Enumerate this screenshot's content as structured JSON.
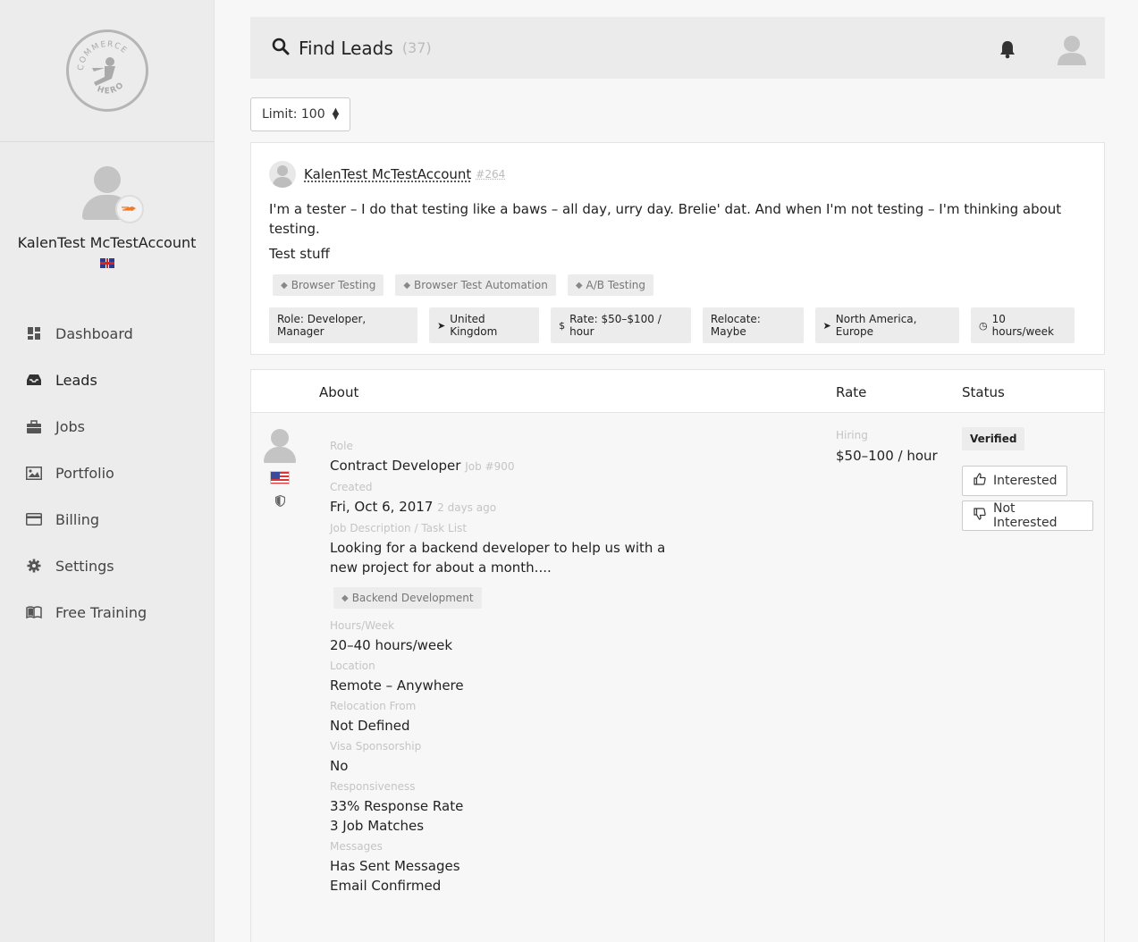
{
  "brand": {
    "logo_text_top": "COMMERCE",
    "logo_text_bottom": "HERO"
  },
  "profile": {
    "name": "KalenTest McTestAccount"
  },
  "nav": [
    {
      "label": "Dashboard",
      "icon": "dashboard-icon"
    },
    {
      "label": "Leads",
      "icon": "inbox-icon"
    },
    {
      "label": "Jobs",
      "icon": "briefcase-icon"
    },
    {
      "label": "Portfolio",
      "icon": "image-icon"
    },
    {
      "label": "Billing",
      "icon": "credit-card-icon"
    },
    {
      "label": "Settings",
      "icon": "gear-icon"
    },
    {
      "label": "Free Training",
      "icon": "book-icon"
    }
  ],
  "header": {
    "title": "Find Leads",
    "count": "(37)"
  },
  "limit": {
    "label": "Limit: 100"
  },
  "lead_profile": {
    "name": "KalenTest McTestAccount",
    "id": "#264",
    "bio": "I'm a tester – I do that testing like a baws – all day, urry day. Brelie' dat. And when I'm not testing – I'm thinking about testing.",
    "bio2": "Test stuff",
    "skills": [
      "Browser Testing",
      "Browser Test Automation",
      "A/B Testing"
    ],
    "chips": {
      "role": "Role: Developer, Manager",
      "country": "United Kingdom",
      "rate": "Rate: $50–$100 / hour",
      "relocate": "Relocate: Maybe",
      "regions": "North America, Europe",
      "hours": "10 hours/week"
    }
  },
  "table": {
    "headers": {
      "about": "About",
      "rate": "Rate",
      "status": "Status"
    },
    "row": {
      "role_label": "Role",
      "role": "Contract Developer",
      "job_id": "Job #900",
      "created_label": "Created",
      "created": "Fri, Oct 6, 2017",
      "created_ago": "2 days ago",
      "desc_label": "Job Description / Task List",
      "desc": "Looking for a backend developer to help us with a new project for about a month....",
      "tag": "Backend Development",
      "hours_label": "Hours/Week",
      "hours": "20–40 hours/week",
      "location_label": "Location",
      "location": "Remote – Anywhere",
      "reloc_label": "Relocation From",
      "reloc": "Not Defined",
      "visa_label": "Visa Sponsorship",
      "visa": "No",
      "resp_label": "Responsiveness",
      "resp_rate": "33% Response Rate",
      "resp_matches": "3 Job Matches",
      "msg_label": "Messages",
      "msg_sent": "Has Sent Messages",
      "msg_email": "Email Confirmed",
      "rate_label": "Hiring",
      "rate": "$50–100 / hour",
      "status_badge": "Verified",
      "interested": "Interested",
      "not_interested": "Not Interested"
    }
  }
}
